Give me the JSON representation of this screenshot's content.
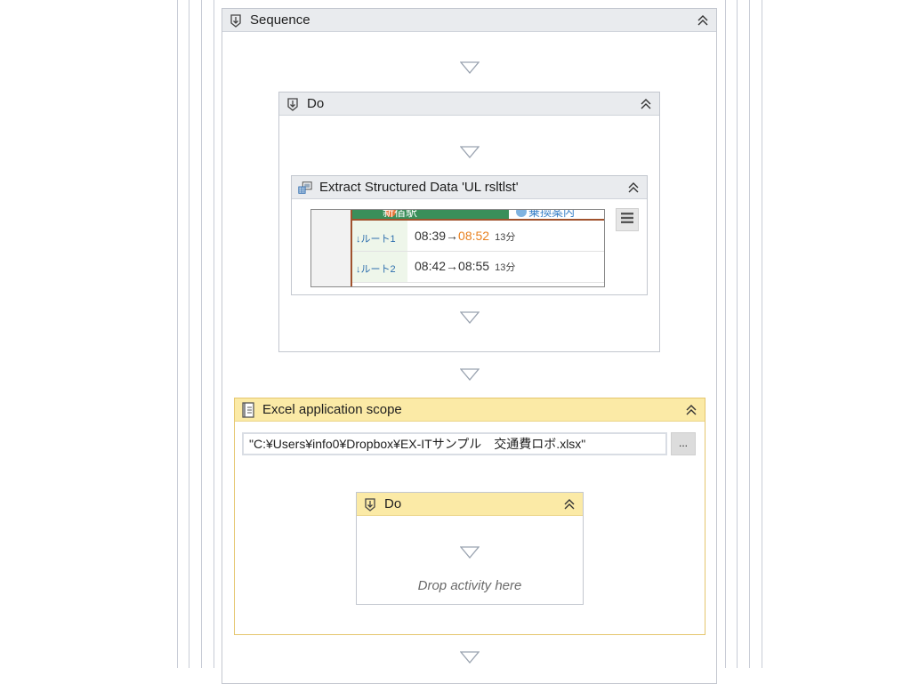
{
  "sequence": {
    "title": "Sequence",
    "icon": "sequence-icon"
  },
  "do_outer": {
    "title": "Do",
    "icon": "sequence-icon"
  },
  "extract": {
    "title": "Extract Structured Data 'UL  rsltlst'",
    "icon": "table-extract-icon",
    "preview": {
      "tab1": "新宿駅",
      "tab2": "乗換案内",
      "rows": [
        {
          "route": "↓ルート1",
          "depart": "08:39→",
          "arrive": "08:52",
          "duration": "13分"
        },
        {
          "route": "↓ルート2",
          "depart": "08:42→",
          "arrive": "08:55",
          "duration": "13分"
        }
      ]
    },
    "menu_icon": "hamburger-menu-icon"
  },
  "excel": {
    "title": "Excel application scope",
    "icon": "excel-book-icon",
    "path_value": "\"C:¥Users¥info0¥Dropbox¥EX-ITサンプル　交通費ロボ.xlsx\"",
    "browse_label": "..."
  },
  "do_inner": {
    "title": "Do",
    "icon": "sequence-icon",
    "drop_hint": "Drop activity here"
  },
  "colors": {
    "excel_header": "#fbeaa6",
    "excel_border": "#e5c66e",
    "card_header": "#e9ebee",
    "highlight_time": "#e8801e"
  }
}
